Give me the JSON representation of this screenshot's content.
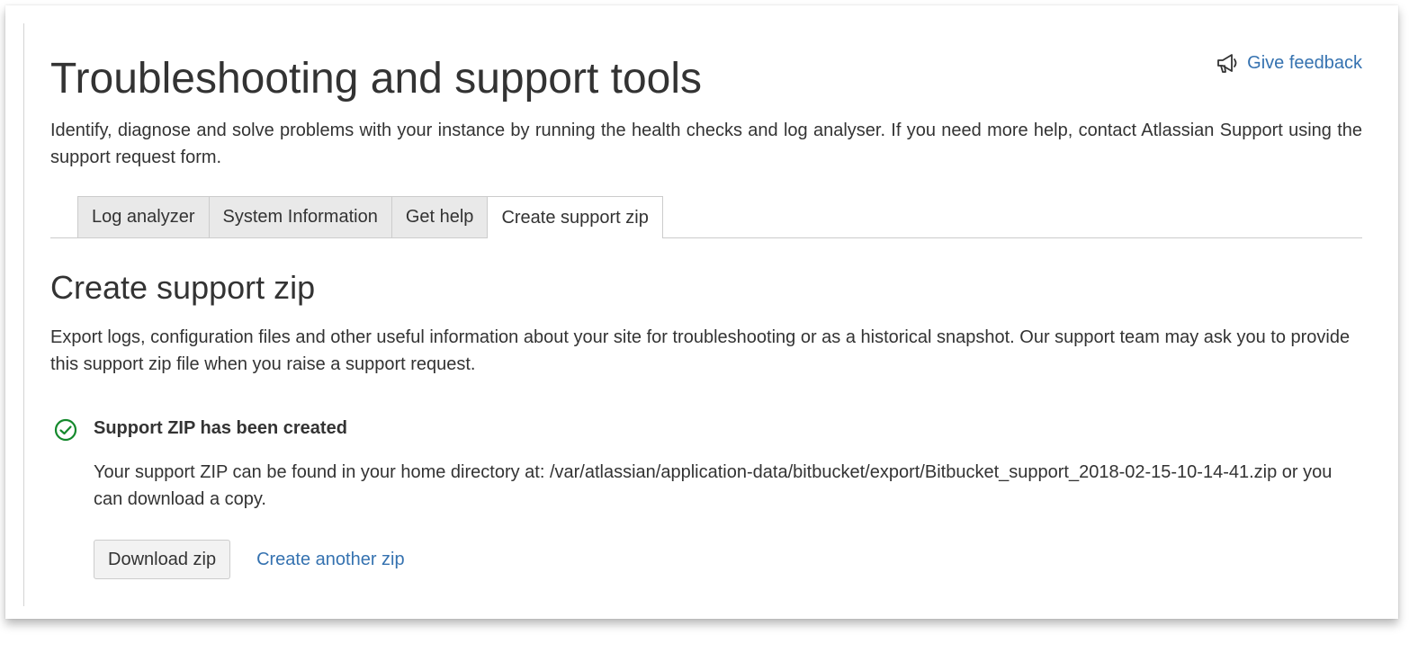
{
  "header": {
    "title": "Troubleshooting and support tools",
    "feedback_label": "Give feedback",
    "feedback_icon": "megaphone-icon",
    "intro": "Identify, diagnose and solve problems with your instance by running the health checks and log analyser. If you need more help, contact Atlassian Support using the support request form."
  },
  "tabs": [
    {
      "label": "Log analyzer",
      "active": false
    },
    {
      "label": "System Information",
      "active": false
    },
    {
      "label": "Get help",
      "active": false
    },
    {
      "label": "Create support zip",
      "active": true
    }
  ],
  "section": {
    "title": "Create support zip",
    "description": "Export logs, configuration files and other useful information about your site for troubleshooting or as a historical snapshot. Our support team may ask you to provide this support zip file when you raise a support request."
  },
  "success": {
    "icon": "check-circle-icon",
    "title": "Support ZIP has been created",
    "body": "Your support ZIP can be found in your home directory at: /var/atlassian/application-data/bitbucket/export/Bitbucket_support_2018-02-15-10-14-41.zip or you can download a copy.",
    "download_label": "Download zip",
    "create_another_label": "Create another zip"
  },
  "colors": {
    "link": "#3572b0",
    "success": "#14892c",
    "text": "#333333",
    "tab_inactive_bg": "#e9e9e9",
    "border": "#cccccc"
  }
}
